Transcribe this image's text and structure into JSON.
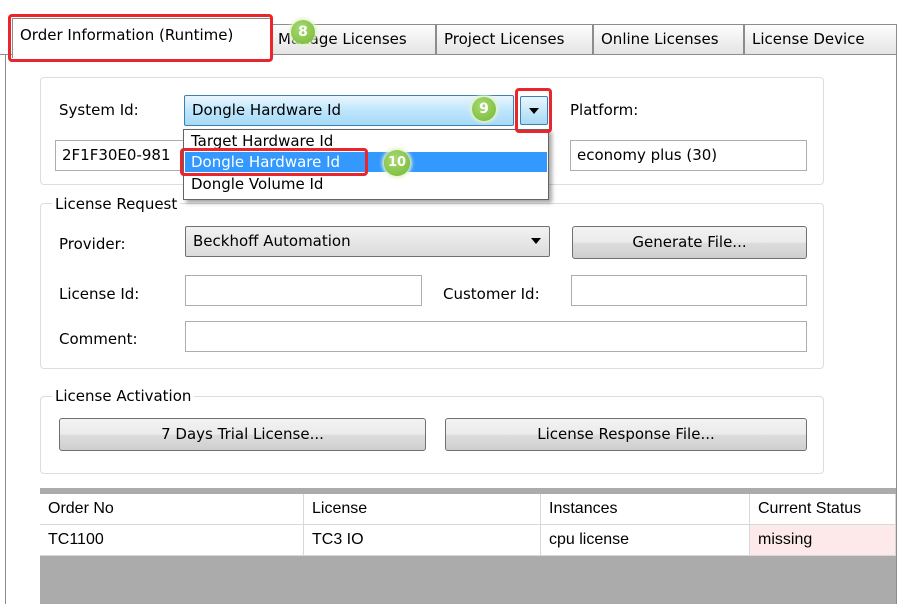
{
  "tabs": [
    {
      "label": "Order Information (Runtime)"
    },
    {
      "label": "Manage Licenses"
    },
    {
      "label": "Project Licenses"
    },
    {
      "label": "Online Licenses"
    },
    {
      "label": "License Device"
    }
  ],
  "system": {
    "system_id_label": "System Id:",
    "system_id_selected": "Dongle Hardware Id",
    "system_id_value": "2F1F30E0-981",
    "platform_label": "Platform:",
    "platform_value": "economy plus (30)",
    "dropdown_options": [
      "Target Hardware Id",
      "Dongle Hardware Id",
      "Dongle Volume Id"
    ]
  },
  "license_request": {
    "title": "License Request",
    "provider_label": "Provider:",
    "provider_value": "Beckhoff Automation",
    "generate_button": "Generate File...",
    "license_id_label": "License Id:",
    "license_id_value": "",
    "customer_id_label": "Customer Id:",
    "customer_id_value": "",
    "comment_label": "Comment:",
    "comment_value": ""
  },
  "license_activation": {
    "title": "License Activation",
    "trial_button": "7 Days Trial License...",
    "response_button": "License Response File..."
  },
  "table": {
    "columns": [
      "Order No",
      "License",
      "Instances",
      "Current Status"
    ],
    "rows": [
      {
        "order_no": "TC1100",
        "license": "TC3 IO",
        "instances": "cpu license",
        "status": "missing"
      }
    ]
  },
  "annotations": {
    "badge_8": "8",
    "badge_9": "9",
    "badge_10": "10"
  },
  "colors": {
    "highlight": "#e8262b",
    "badge": "#75b832",
    "selection": "#3399ff",
    "missing_status_bg": "#fde9e9"
  }
}
